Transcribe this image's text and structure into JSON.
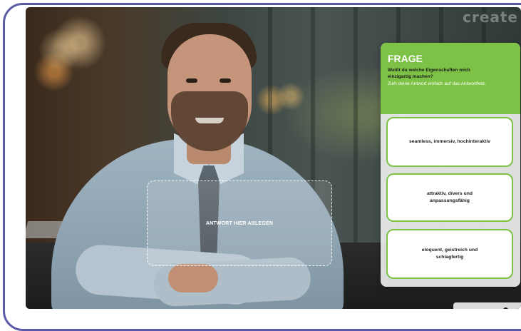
{
  "watermark": "create",
  "dropzone": {
    "label": "ANTWORT HIER ABLEGEN"
  },
  "panel": {
    "title": "FRAGE",
    "question": "Weißt du welche Eigenschaften mich einzigartig machen?",
    "instruction": "Zieh deine Antwort einfach auf das Antwortfeld.",
    "accent_color": "#7dc246"
  },
  "answers": [
    {
      "label": "seamless, immersiv, hochinteraktiv"
    },
    {
      "label": "attraktiv, divers und anpassungsfähig"
    },
    {
      "label": "eloquent, geistreich und schlagfertig"
    }
  ],
  "controls": {
    "play_icon": "play-icon",
    "volume_icon": "volume-icon"
  }
}
